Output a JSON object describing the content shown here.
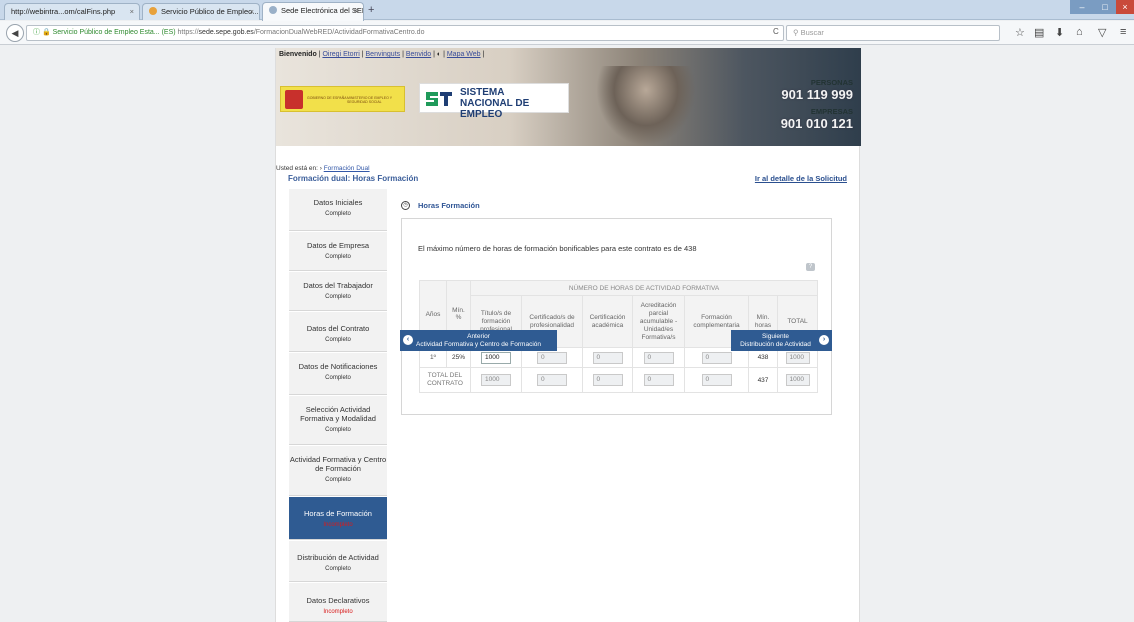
{
  "browser": {
    "tabs": [
      {
        "label": "http://webintra...om/calFins.php"
      },
      {
        "label": "Servicio Público de Empleo..."
      },
      {
        "label": "Sede Electrónica del SEPE. ..."
      }
    ],
    "new_tab": "+",
    "url": {
      "site_label": "Servicio Público de Empleo Esta... (ES)",
      "scheme": "https://",
      "host": "sede.sepe.gob.es",
      "path": "/FormacionDualWebRED/ActividadFormativaCentro.do"
    },
    "search_placeholder": "Buscar"
  },
  "header": {
    "welcome": "Bienvenido",
    "user": "Oiregi Etorri",
    "links": [
      "Benvinguts",
      "Benvido",
      "Mapa Web"
    ],
    "gov_text": [
      "GOBIERNO DE ESPAÑA",
      "MINISTERIO DE EMPLEO Y SEGURIDAD SOCIAL"
    ],
    "ministry_text": "SERVICIO PÚBLICO DE EMPLEO ESTATAL",
    "sne_line1": "SISTEMA",
    "sne_line2": "NACIONAL DE EMPLEO",
    "personas_label": "PERSONAS",
    "personas_phone": "901 119 999",
    "empresas_label": "EMPRESAS",
    "empresas_phone": "901 010 121"
  },
  "breadcrumb": {
    "prefix": "Usted está en:",
    "link": "Formación Dual"
  },
  "page_title": "Formación dual: Horas Formación",
  "detail_link": "Ir al detalle de la Solicitud",
  "sidebar": [
    {
      "label": "Datos Iniciales",
      "state": "Completo"
    },
    {
      "label": "Datos de Empresa",
      "state": "Completo"
    },
    {
      "label": "Datos del Trabajador",
      "state": "Completo"
    },
    {
      "label": "Datos del Contrato",
      "state": "Completo"
    },
    {
      "label": "Datos de Notificaciones",
      "state": "Completo"
    },
    {
      "label": "Selección Actividad Formativa y Modalidad",
      "state": "Completo"
    },
    {
      "label": "Actividad Formativa y Centro de Formación",
      "state": "Completo"
    },
    {
      "label": "Horas de Formación",
      "state": "Incompleto"
    },
    {
      "label": "Distribución de Actividad",
      "state": "Completo"
    },
    {
      "label": "Datos Declarativos",
      "state": "Incompleto"
    }
  ],
  "main": {
    "section_title": "Horas Formación",
    "max_text": "El máximo número de horas de formación bonificables para este contrato es de 438",
    "help": "?",
    "table": {
      "group_header": "NÚMERO DE HORAS DE ACTIVIDAD FORMATIVA",
      "col_years": "Años",
      "col_min_pct": "Mín. %",
      "columns": [
        "Título/s de formación profesional",
        "Certificado/s de profesionalidad",
        "Certificación académica",
        "Acreditación parcial acumulable - Unidad/es Formativa/s",
        "Formación complementaria",
        "Mín. horas",
        "TOTAL"
      ],
      "row": {
        "year": "1º",
        "min_pct": "25%",
        "titulo": "1000",
        "certificado": "0",
        "certificacion": "0",
        "acreditacion": "0",
        "complementaria": "0",
        "min_horas": "438",
        "total": "1000"
      },
      "total_row": {
        "label": "TOTAL DEL CONTRATO",
        "titulo": "1000",
        "certificado": "0",
        "certificacion": "0",
        "acreditacion": "0",
        "complementaria": "0",
        "min_horas": "437",
        "total": "1000"
      }
    },
    "prev_button": {
      "line1": "Anterior",
      "line2": "Actividad Formativa y Centro de Formación"
    },
    "next_button": {
      "line1": "Siguiente",
      "line2": "Distribución de Actividad"
    }
  },
  "colors": {
    "primary": "#2f5b92",
    "incomplete": "#d81b1b",
    "title": "#3b5e9a"
  },
  "icons": [
    "back-arrow-icon",
    "reload-icon",
    "search-icon",
    "star-icon",
    "bookmarks-icon",
    "download-icon",
    "home-icon",
    "pocket-icon",
    "menu-icon",
    "clock-icon",
    "help-icon",
    "chevron-left-icon",
    "chevron-right-icon"
  ]
}
